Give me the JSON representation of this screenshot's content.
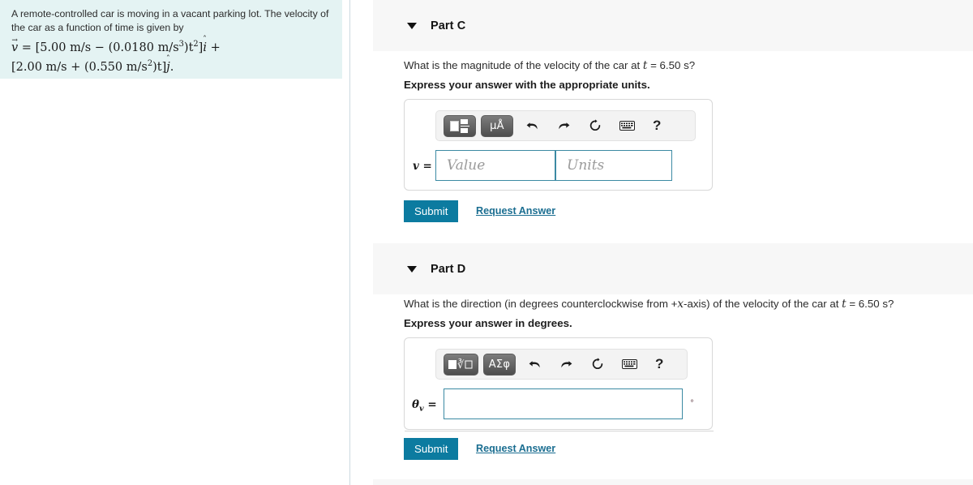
{
  "problem": {
    "paragraph": "A remote-controlled car is moving in a vacant parking lot. The velocity of the car as a function of time is given by",
    "equation_line1_prefix": "v",
    "equation_line1": " = [5.00 m/s − (0.0180 m/s",
    "equation_line1_exp": "3",
    "equation_line1_mid": ")t",
    "equation_line1_exp2": "2",
    "equation_line1_end": "]",
    "equation_line1_unit": "i",
    "equation_line1_plus": " +",
    "equation_line2": "[2.00 m/s + (0.550 m/s",
    "equation_line2_exp": "2",
    "equation_line2_mid": ")t]",
    "equation_line2_unit": "j",
    "equation_line2_end": "."
  },
  "part_c": {
    "title": "Part C",
    "question_pre": "What is the magnitude of the velocity of the car at ",
    "question_var": "t",
    "question_post": " = 6.50 s?",
    "instruction": "Express your answer with the appropriate units.",
    "toolbar": {
      "template_button": "template-icon",
      "units_button": "μÅ",
      "undo": "↶",
      "redo": "↷",
      "reset": "⟳",
      "keyboard": "keyboard-icon",
      "help": "?"
    },
    "label": "v =",
    "value_placeholder": "Value",
    "units_placeholder": "Units",
    "value_current": "",
    "units_current": "",
    "submit_label": "Submit",
    "request_label": "Request Answer"
  },
  "part_d": {
    "title": "Part D",
    "question_pre": "What is the direction (in degrees counterclockwise from +",
    "question_var": "x",
    "question_mid": "-axis) of the velocity of the car at ",
    "question_var2": "t",
    "question_post": " = 6.50 s?",
    "instruction": "Express your answer in degrees.",
    "toolbar": {
      "radical_button": "radical-icon",
      "greek_button": "ΑΣφ",
      "undo": "↶",
      "redo": "↷",
      "reset": "⟳",
      "keyboard": "keyboard-icon",
      "help": "?"
    },
    "label": "θ",
    "label_sub": "v",
    "label_eq": " =",
    "answer_current": "",
    "degree_symbol": "°",
    "submit_label": "Submit",
    "request_label": "Request Answer"
  },
  "colors": {
    "problem_panel_bg": "#e4f3f3",
    "header_bg": "#f7f7f7",
    "submit_bg": "#0c7ba0",
    "link": "#1b6e91",
    "field_border": "#3c8aa3"
  }
}
